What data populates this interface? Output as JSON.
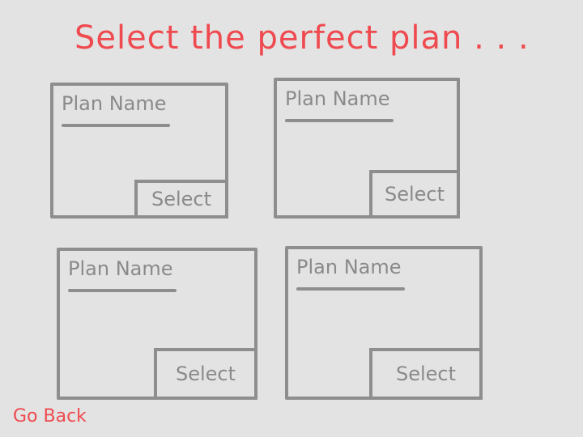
{
  "title": "Select the perfect plan . . .",
  "plans": [
    {
      "name": "Plan Name",
      "select_label": "Select"
    },
    {
      "name": "Plan Name",
      "select_label": "Select"
    },
    {
      "name": "Plan Name",
      "select_label": "Select"
    },
    {
      "name": "Plan Name",
      "select_label": "Select"
    }
  ],
  "go_back_label": "Go Back",
  "colors": {
    "accent": "#ef4a4f",
    "sketch_gray": "#8e8e8e",
    "background": "#e3e3e3"
  }
}
